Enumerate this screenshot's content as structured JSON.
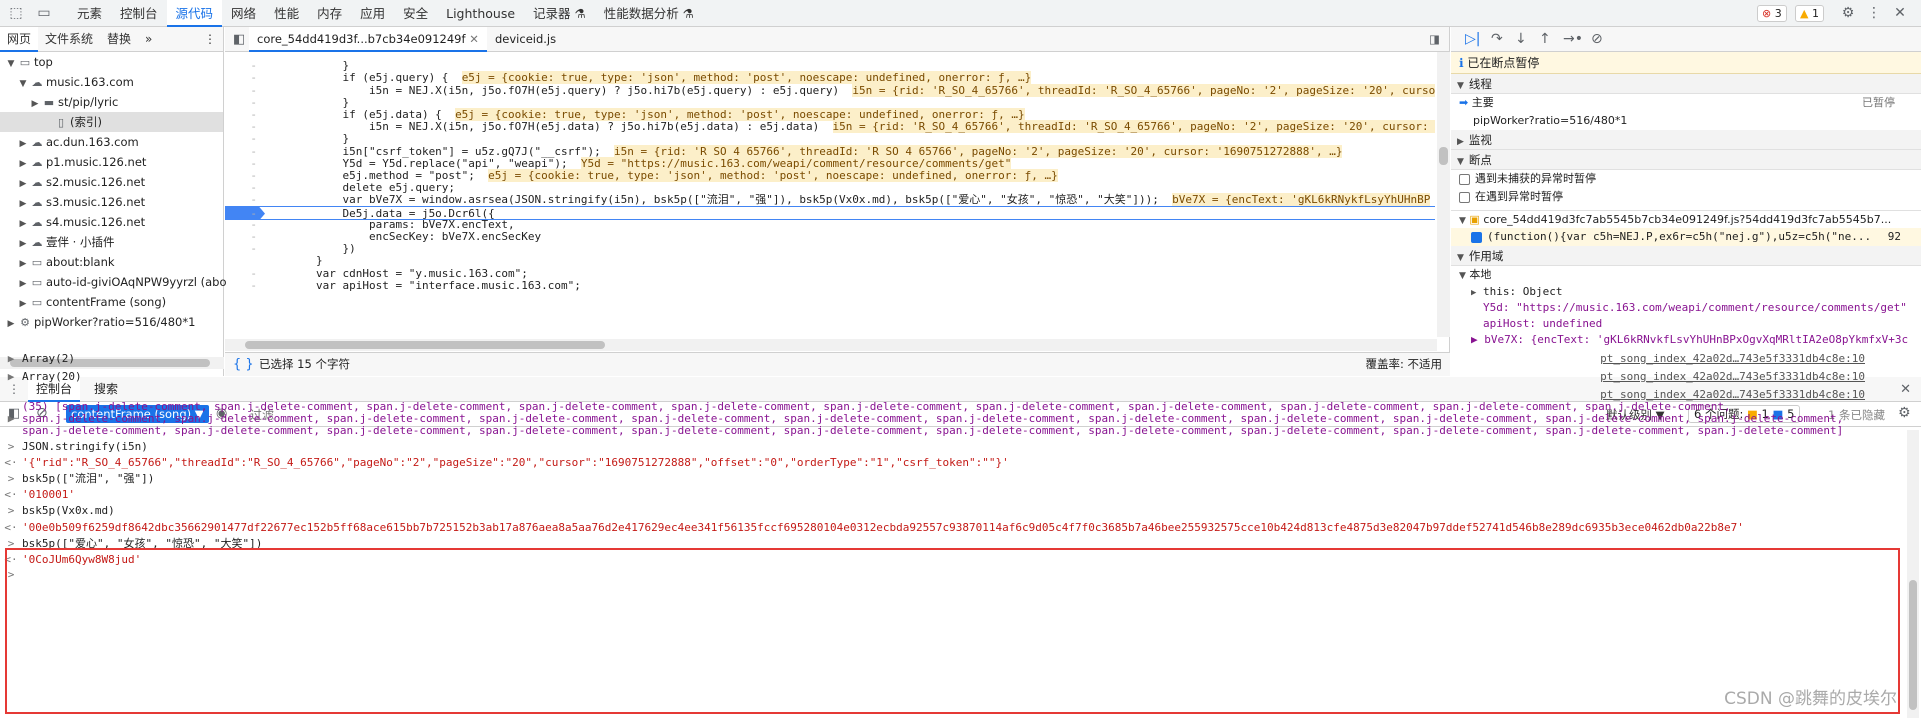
{
  "top_tabs": [
    "元素",
    "控制台",
    "源代码",
    "网络",
    "性能",
    "内存",
    "应用",
    "安全",
    "Lighthouse",
    "记录器 ⚗",
    "性能数据分析 ⚗"
  ],
  "active_top_tab": "源代码",
  "badges": {
    "errors": "3",
    "warnings": "1"
  },
  "left": {
    "tabs": [
      "网页",
      "文件系统",
      "替换",
      "»"
    ],
    "tree": [
      {
        "label": "top",
        "level": 0,
        "arrow": "▼",
        "icon": "frame"
      },
      {
        "label": "music.163.com",
        "level": 1,
        "arrow": "▼",
        "icon": "cloud"
      },
      {
        "label": "st/pip/lyric",
        "level": 2,
        "arrow": "▶",
        "icon": "folder"
      },
      {
        "label": "(索引)",
        "level": 3,
        "arrow": "",
        "icon": "file",
        "selected": true
      },
      {
        "label": "ac.dun.163.com",
        "level": 1,
        "arrow": "▶",
        "icon": "cloud"
      },
      {
        "label": "p1.music.126.net",
        "level": 1,
        "arrow": "▶",
        "icon": "cloud"
      },
      {
        "label": "s2.music.126.net",
        "level": 1,
        "arrow": "▶",
        "icon": "cloud"
      },
      {
        "label": "s3.music.126.net",
        "level": 1,
        "arrow": "▶",
        "icon": "cloud"
      },
      {
        "label": "s4.music.126.net",
        "level": 1,
        "arrow": "▶",
        "icon": "cloud"
      },
      {
        "label": "壹伴 · 小插件",
        "level": 1,
        "arrow": "▶",
        "icon": "cloud"
      },
      {
        "label": "about:blank",
        "level": 1,
        "arrow": "▶",
        "icon": "frame"
      },
      {
        "label": "auto-id-giviOAqNPW9yyrzl (abo",
        "level": 1,
        "arrow": "▶",
        "icon": "frame"
      },
      {
        "label": "contentFrame (song)",
        "level": 1,
        "arrow": "▶",
        "icon": "frame"
      },
      {
        "label": "pipWorker?ratio=516/480*1",
        "level": 0,
        "arrow": "▶",
        "icon": "gear"
      }
    ]
  },
  "editor": {
    "tabs": [
      "core_54dd419d3f...b7cb34e091249f",
      "deviceid.js"
    ],
    "lines": [
      {
        "gutter": "",
        "code": "            ",
        "cls": ""
      },
      {
        "gutter": "-",
        "code": "            }",
        "cls": ""
      },
      {
        "gutter": "-",
        "code": "            if (e5j.query) {  ",
        "inline": "e5j = {cookie: true, type: 'json', method: 'post', noescape: undefined, onerror: ƒ, …}"
      },
      {
        "gutter": "-",
        "code": "                i5n = NEJ.X(i5n, j5o.fO7H(e5j.query) ? j5o.hi7b(e5j.query) : e5j.query)  ",
        "inline": "i5n = {rid: 'R_SO_4_65766', threadId: 'R_SO_4_65766', pageNo: '2', pageSize: '20', cursor"
      },
      {
        "gutter": "-",
        "code": "            }",
        "cls": ""
      },
      {
        "gutter": "-",
        "code": "            if (e5j.data) {  ",
        "inline": "e5j = {cookie: true, type: 'json', method: 'post', noescape: undefined, onerror: ƒ, …}"
      },
      {
        "gutter": "-",
        "code": "                i5n = NEJ.X(i5n, j5o.fO7H(e5j.data) ? j5o.hi7b(e5j.data) : e5j.data)  ",
        "inline": "i5n = {rid: 'R_SO_4_65766', threadId: 'R_SO_4_65766', pageNo: '2', pageSize: '20', cursor: '"
      },
      {
        "gutter": "-",
        "code": "            }",
        "cls": ""
      },
      {
        "gutter": "-",
        "code": "            i5n[\"csrf_token\"] = u5z.gQ7J(\"__csrf\");  ",
        "inline": "i5n = {rid: 'R_SO_4_65766', threadId: 'R_SO_4_65766', pageNo: '2', pageSize: '20', cursor: '1690751272888', …}"
      },
      {
        "gutter": "-",
        "code": "            Y5d = Y5d.replace(\"api\", \"weapi\");  ",
        "inline": "Y5d = \"https://music.163.com/weapi/comment/resource/comments/get\""
      },
      {
        "gutter": "-",
        "code": "            e5j.method = \"post\";  ",
        "inline": "e5j = {cookie: true, type: 'json', method: 'post', noescape: undefined, onerror: ƒ, …}"
      },
      {
        "gutter": "-",
        "code": "            delete e5j.query;",
        "cls": ""
      },
      {
        "gutter": "-",
        "code": "            var bVe7X = window.asrsea(JSON.stringify(i5n), bsk5p([\"流泪\", \"强\"]), bsk5p(Vx0x.md), bsk5p([\"爱心\", \"女孩\", \"惊恐\", \"大笑\"]));  ",
        "inline": "bVe7X = {encText: 'gKL6kRNykfLsyYhUHnBP"
      },
      {
        "gutter": "-",
        "code": "            De5j.data = j5o.Dcr6l({",
        "cls": "bp"
      },
      {
        "gutter": "-",
        "code": "                params: bVe7X.encText,",
        "cls": ""
      },
      {
        "gutter": "-",
        "code": "                encSecKey: bVe7X.encSecKey",
        "cls": ""
      },
      {
        "gutter": "-",
        "code": "            })",
        "cls": ""
      },
      {
        "gutter": "",
        "code": "        }",
        "cls": ""
      },
      {
        "gutter": "-",
        "code": "        var cdnHost = \"y.music.163.com\";",
        "cls": ""
      },
      {
        "gutter": "-",
        "code": "        var apiHost = \"interface.music.163.com\";",
        "cls": ""
      }
    ],
    "status_left": "已选择 15 个字符",
    "status_right": "覆盖率: 不适用"
  },
  "right": {
    "paused": "已在断点暂停",
    "sections": {
      "threads": "线程",
      "main": "主要",
      "main_state": "已暂停",
      "worker": "pipWorker?ratio=516/480*1",
      "watch": "监视",
      "breakpoints": "断点",
      "bp_uncaught": "遇到未捕获的异常时暂停",
      "bp_caught": "在遇到异常时暂停",
      "bp_file": "core_54dd419d3fc7ab5545b7cb34e091249f.js?54dd419d3fc7ab5545b7...",
      "bp_code": "(function(){var c5h=NEJ.P,ex6r=c5h(\"nej.g\"),u5z=c5h(\"ne...",
      "bp_line": "92",
      "scope": "作用域",
      "local": "本地",
      "this_val": "this: Object",
      "y5d": "Y5d: \"https://music.163.com/weapi/comment/resource/comments/get\"",
      "apihost": "apiHost: undefined",
      "bve7x": "▶ bVe7X: {encText: 'gKL6kRNvkfLsvYhUHnBPxOgvXqMRltIA2eO8pYkmfxV+3c"
    }
  },
  "drawer": {
    "tabs": [
      "控制台",
      "搜索"
    ],
    "context": "contentFrame (song)",
    "filter_placeholder": "过滤",
    "level": "默认级别",
    "issues": "6 个问题:",
    "issue_a": "1",
    "issue_b": "5",
    "hidden": "1 条已隐藏"
  },
  "console": [
    {
      "pfx": "▶",
      "text": "Array(2)",
      "src": "pt_song_index_42a02d…743e5f3331db4c8e:10",
      "color": "#1f1f1f"
    },
    {
      "pfx": "▶",
      "text": "Array(20)",
      "src": "pt_song_index_42a02d…743e5f3331db4c8e:10",
      "color": "#1f1f1f"
    },
    {
      "pfx": "",
      "text": "",
      "src": "pt_song_index_42a02d…743e5f3331db4c8e:10",
      "color": "#1f1f1f"
    },
    {
      "pfx": "",
      "text": "(35) [span.j-delete-comment, span.j-delete-comment, span.j-delete-comment, span.j-delete-comment, span.j-delete-comment, span.j-delete-comment, span.j-delete-comment, span.j-delete-comment, span.j-delete-comment, span.j-delete-comment, span.j-delete-comment,",
      "src": "",
      "color": "#881391"
    },
    {
      "pfx": "▶",
      "text": "span.j-delete-comment, span.j-delete-comment, span.j-delete-comment, span.j-delete-comment, span.j-delete-comment, span.j-delete-comment, span.j-delete-comment, span.j-delete-comment, span.j-delete-comment, span.j-delete-comment, span.j-delete-comment, span.j-delete-comment,",
      "src": "",
      "color": "#881391"
    },
    {
      "pfx": "",
      "text": "span.j-delete-comment, span.j-delete-comment, span.j-delete-comment, span.j-delete-comment, span.j-delete-comment, span.j-delete-comment, span.j-delete-comment, span.j-delete-comment, span.j-delete-comment, span.j-delete-comment, span.j-delete-comment, span.j-delete-comment]",
      "src": "",
      "color": "#881391"
    },
    {
      "pfx": ">",
      "text": "JSON.stringify(i5n)",
      "src": "",
      "color": "#1f1f1f"
    },
    {
      "pfx": "<·",
      "text": "'{\"rid\":\"R_SO_4_65766\",\"threadId\":\"R_SO_4_65766\",\"pageNo\":\"2\",\"pageSize\":\"20\",\"cursor\":\"1690751272888\",\"offset\":\"0\",\"orderType\":\"1\",\"csrf_token\":\"\"}'",
      "src": "",
      "color": "#c41a16"
    },
    {
      "pfx": ">",
      "text": "bsk5p([\"流泪\", \"强\"])",
      "src": "",
      "color": "#1f1f1f"
    },
    {
      "pfx": "<·",
      "text": "'010001'",
      "src": "",
      "color": "#c41a16"
    },
    {
      "pfx": ">",
      "text": "bsk5p(Vx0x.md)",
      "src": "",
      "color": "#1f1f1f"
    },
    {
      "pfx": "<·",
      "text": "'00e0b509f6259df8642dbc35662901477df22677ec152b5ff68ace615bb7b725152b3ab17a876aea8a5aa76d2e417629ec4ee341f56135fccf695280104e0312ecbda92557c93870114af6c9d05c4f7f0c3685b7a46bee255932575cce10b424d813cfe4875d3e82047b97ddef52741d546b8e289dc6935b3ece0462db0a22b8e7'",
      "src": "",
      "color": "#c41a16"
    },
    {
      "pfx": ">",
      "text": "bsk5p([\"爱心\", \"女孩\", \"惊恐\", \"大笑\"])",
      "src": "",
      "color": "#1f1f1f"
    },
    {
      "pfx": "<·",
      "text": "'0CoJUm6Qyw8W8jud'",
      "src": "",
      "color": "#c41a16"
    },
    {
      "pfx": ">",
      "text": "",
      "src": "",
      "color": "#1a73e8"
    }
  ],
  "watermark": "CSDN @跳舞的皮埃尔"
}
